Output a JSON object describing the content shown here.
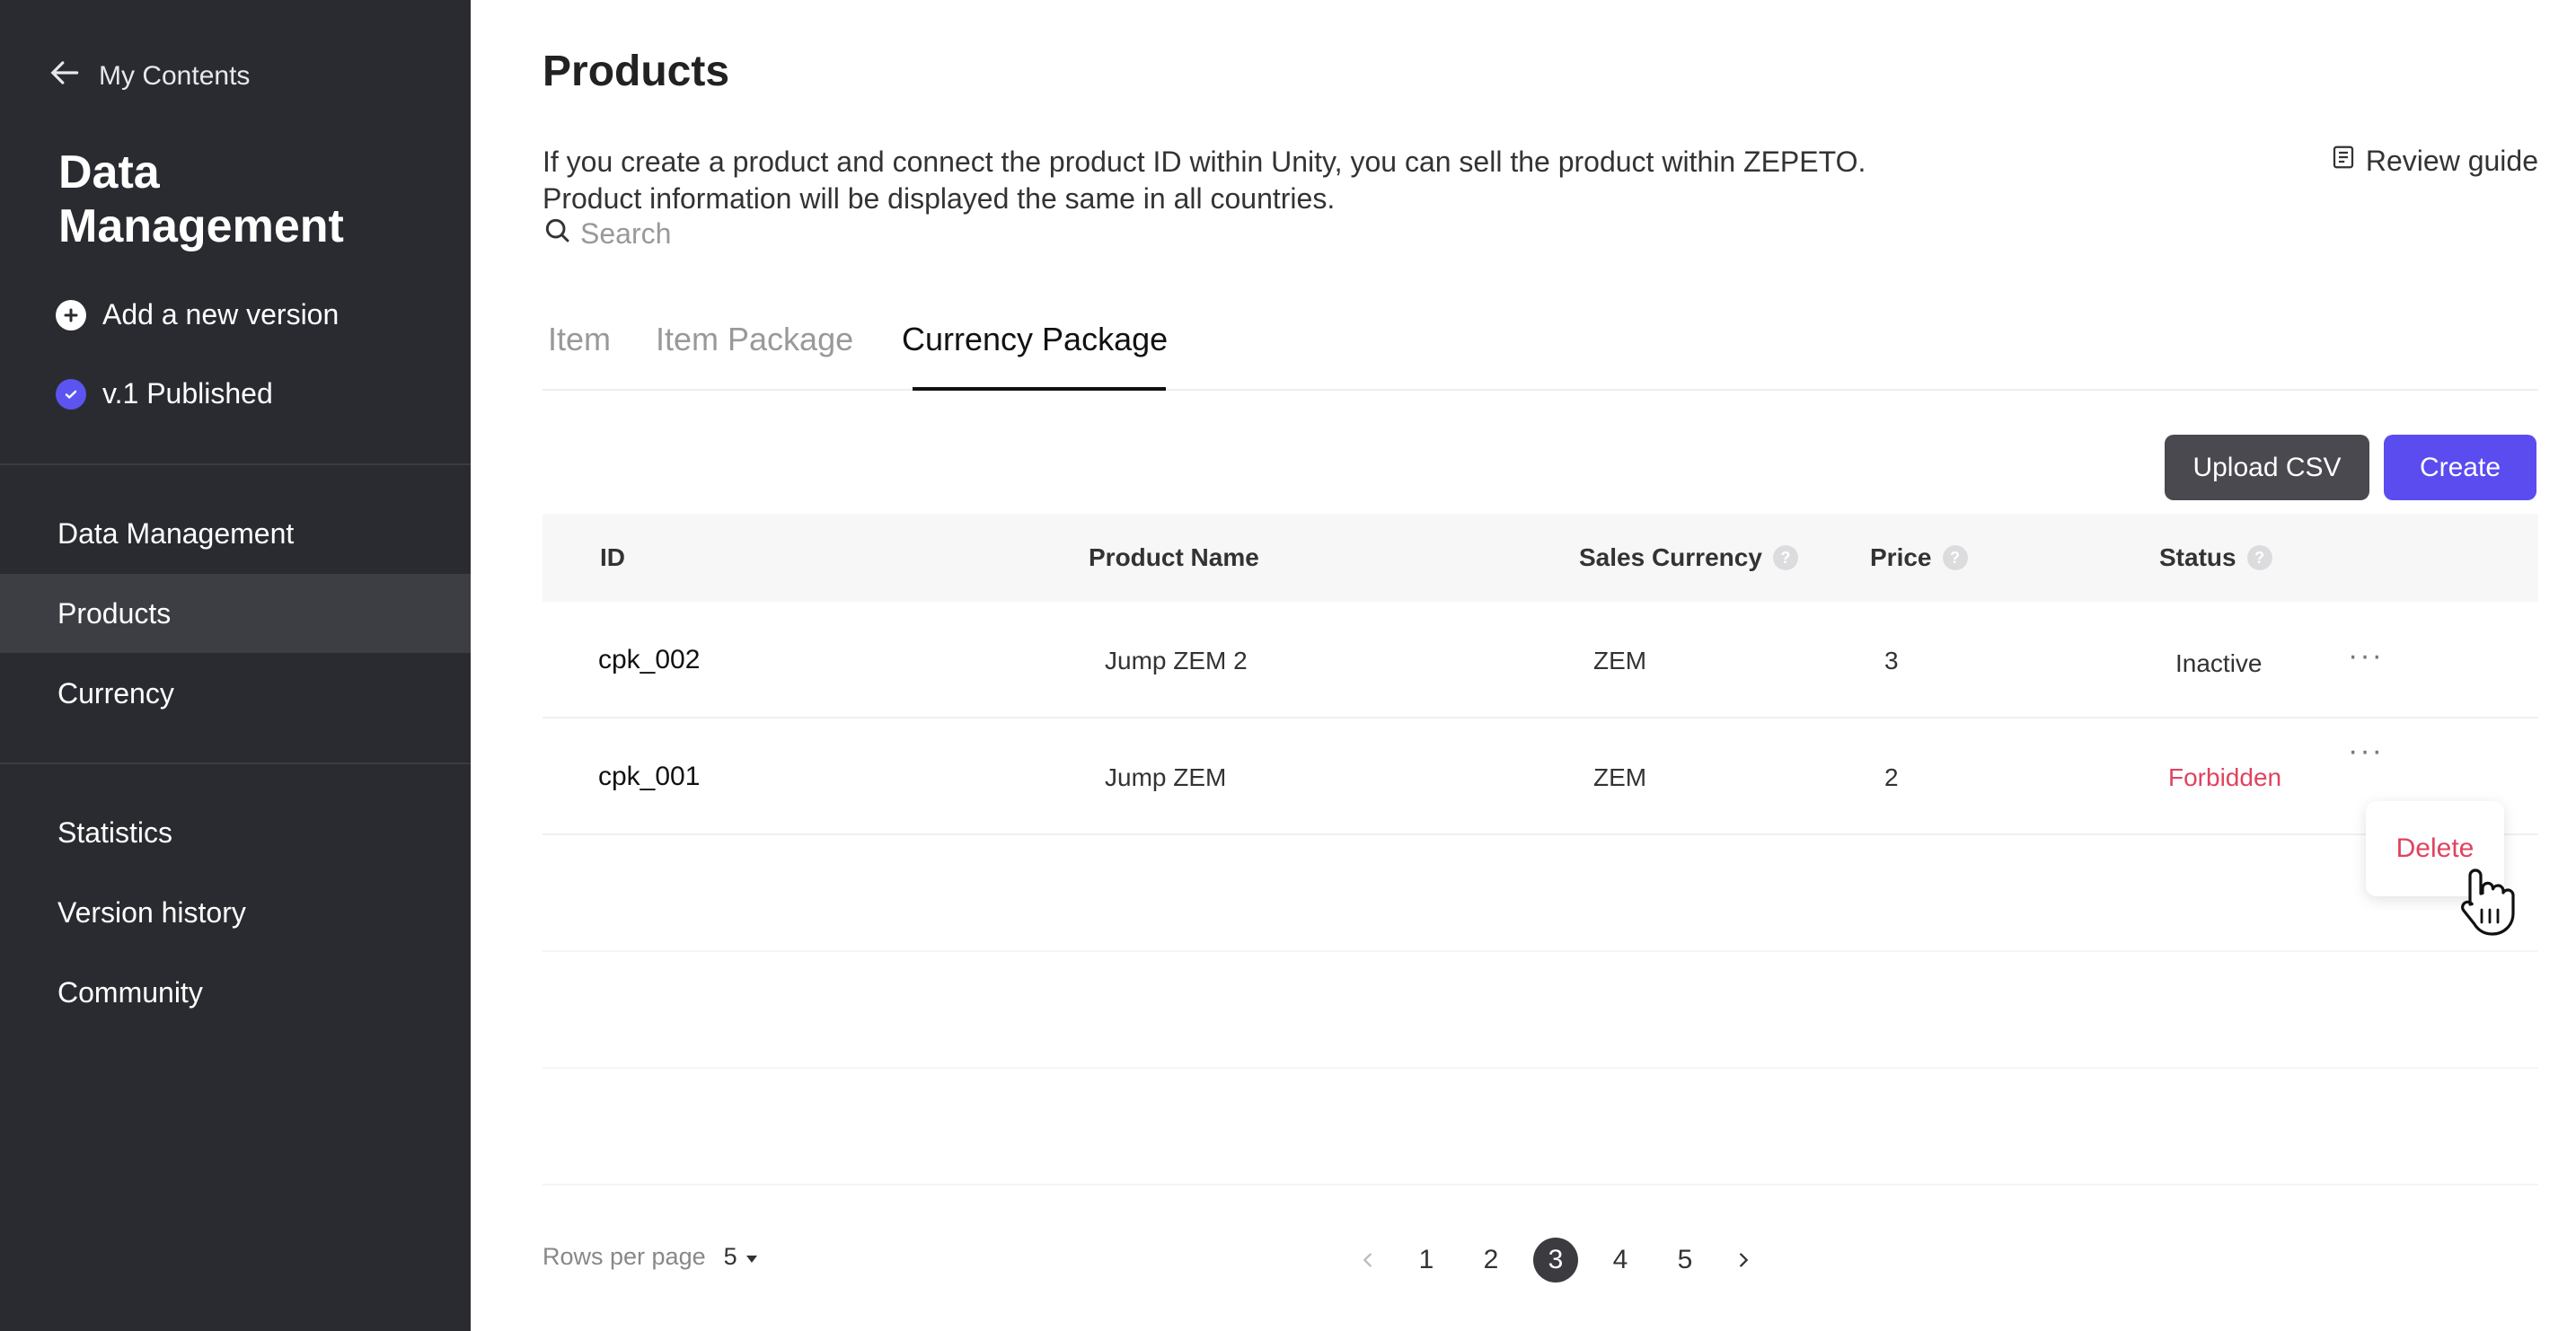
{
  "sidebar": {
    "back_label": "My Contents",
    "title": "Data Management",
    "add_version": "Add a new version",
    "published": "v.1 Published",
    "nav_main": [
      {
        "label": "Data Management"
      },
      {
        "label": "Products"
      },
      {
        "label": "Currency"
      }
    ],
    "nav_secondary": [
      {
        "label": "Statistics"
      },
      {
        "label": "Version history"
      },
      {
        "label": "Community"
      }
    ],
    "active_item": "Products"
  },
  "header": {
    "title": "Products",
    "description_line1": "If you create a product and connect the product ID within Unity, you can sell the product within ZEPETO.",
    "description_line2": "Product information will be displayed the same in all countries.",
    "review_guide": "Review guide"
  },
  "search": {
    "placeholder": "Search",
    "value": ""
  },
  "tabs": [
    {
      "label": "Item"
    },
    {
      "label": "Item Package"
    },
    {
      "label": "Currency Package"
    }
  ],
  "active_tab": "Currency Package",
  "toolbar": {
    "upload_csv": "Upload CSV",
    "create": "Create"
  },
  "table": {
    "columns": [
      "ID",
      "Product Name",
      "Sales Currency",
      "Price",
      "Status"
    ],
    "rows": [
      {
        "id": "cpk_002",
        "name": "Jump ZEM 2",
        "currency": "ZEM",
        "price": "3",
        "status": "Inactive"
      },
      {
        "id": "cpk_001",
        "name": "Jump ZEM",
        "currency": "ZEM",
        "price": "2",
        "status": "Forbidden"
      }
    ],
    "more_label": "···"
  },
  "row_menu": {
    "delete": "Delete"
  },
  "pagination": {
    "rows_per_page_label": "Rows per page",
    "rows_per_page_value": "5",
    "pages": [
      "1",
      "2",
      "3",
      "4",
      "5"
    ],
    "current_page": "3"
  },
  "colors": {
    "sidebar_bg": "#2a2b30",
    "accent": "#5b4cf0",
    "danger": "#e0435f"
  },
  "icons": {
    "back": "arrow-left-icon",
    "add": "plus-circle-icon",
    "published": "check-circle-icon",
    "search": "search-icon",
    "guide": "document-icon",
    "help": "question-icon",
    "more": "more-horizontal-icon",
    "cursor": "hand-pointer-icon"
  }
}
